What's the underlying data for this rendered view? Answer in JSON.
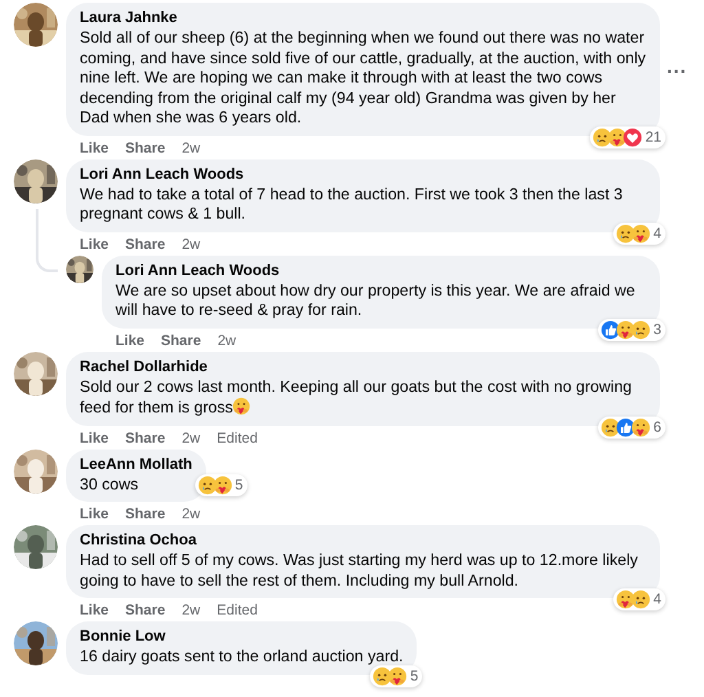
{
  "comments": [
    {
      "author": "Laura Jahnke",
      "text": "Sold all of our sheep (6) at the beginning when we found out there was no water coming, and have since sold five of our cattle, gradually, at the auction, with only nine left. We are hoping we can make it through with at least the two cows decending from the original calf my (94 year old) Grandma was given by her Dad when she was 6 years old.",
      "actions": [
        "Like",
        "Share"
      ],
      "time": "2w",
      "reactions": [
        {
          "kind": "sad"
        },
        {
          "kind": "care"
        },
        {
          "kind": "love"
        }
      ],
      "reaction_count": "21",
      "more": "..."
    },
    {
      "author": "Lori Ann Leach Woods",
      "text": "We had to take a total of 7 head to the auction. First we took 3 then the last 3 pregnant cows & 1 bull.",
      "actions": [
        "Like",
        "Share"
      ],
      "time": "2w",
      "reactions": [
        {
          "kind": "sad"
        },
        {
          "kind": "care"
        }
      ],
      "reaction_count": "4",
      "replies": [
        {
          "author": "Lori Ann Leach Woods",
          "text": "We are so upset about how dry our property is this year. We are afraid we will have to re-seed & pray for rain.",
          "actions": [
            "Like",
            "Share"
          ],
          "time": "2w",
          "reactions": [
            {
              "kind": "like"
            },
            {
              "kind": "care"
            },
            {
              "kind": "sad"
            }
          ],
          "reaction_count": "3"
        }
      ]
    },
    {
      "author": "Rachel Dollarhide",
      "text": "Sold our 2 cows last month. Keeping all our goats but the cost with no growing feed for them is gross",
      "text_icon": {
        "kind": "care"
      },
      "actions": [
        "Like",
        "Share"
      ],
      "time": "2w",
      "edited": "Edited",
      "reactions": [
        {
          "kind": "sad"
        },
        {
          "kind": "like"
        },
        {
          "kind": "care"
        }
      ],
      "reaction_count": "6"
    },
    {
      "author": "LeeAnn Mollath",
      "text": "30 cows",
      "actions": [
        "Like",
        "Share"
      ],
      "time": "2w",
      "reactions": [
        {
          "kind": "sad"
        },
        {
          "kind": "care"
        }
      ],
      "reaction_count": "5"
    },
    {
      "author": "Christina Ochoa",
      "text": "Had to sell off 5 of my cows. Was just starting my herd was up to 12.more likely going to have to sell the rest of them. Including my bull Arnold.",
      "actions": [
        "Like",
        "Share"
      ],
      "time": "2w",
      "edited": "Edited",
      "reactions": [
        {
          "kind": "care"
        },
        {
          "kind": "sad"
        }
      ],
      "reaction_count": "4"
    },
    {
      "author": "Bonnie Low",
      "text": "16 dairy goats sent to the orland auction yard.",
      "reactions": [
        {
          "kind": "sad"
        },
        {
          "kind": "care"
        }
      ],
      "reaction_count": "5"
    }
  ]
}
